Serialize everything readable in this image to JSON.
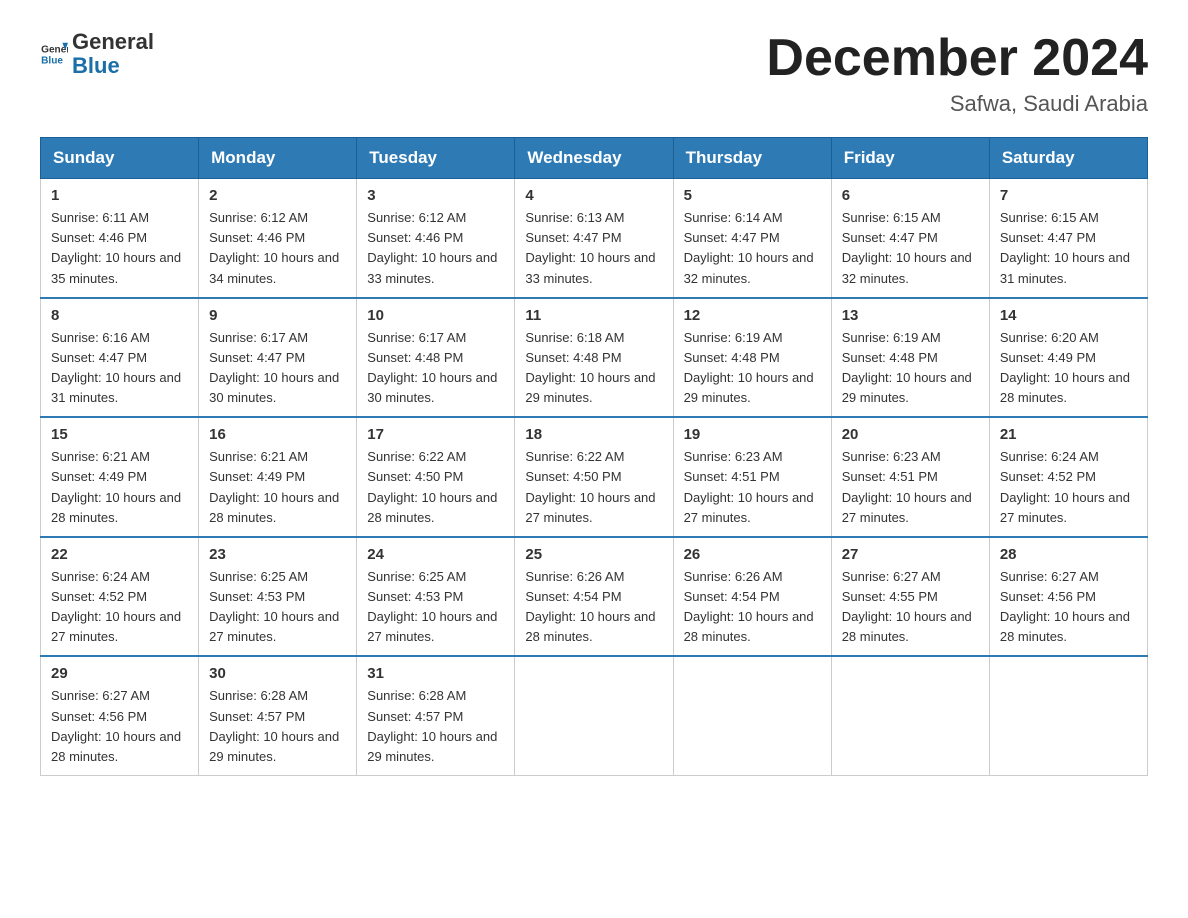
{
  "header": {
    "logo_general": "General",
    "logo_blue": "Blue",
    "month_title": "December 2024",
    "location": "Safwa, Saudi Arabia"
  },
  "days_of_week": [
    "Sunday",
    "Monday",
    "Tuesday",
    "Wednesday",
    "Thursday",
    "Friday",
    "Saturday"
  ],
  "weeks": [
    [
      {
        "day": "1",
        "sunrise": "6:11 AM",
        "sunset": "4:46 PM",
        "daylight": "10 hours and 35 minutes."
      },
      {
        "day": "2",
        "sunrise": "6:12 AM",
        "sunset": "4:46 PM",
        "daylight": "10 hours and 34 minutes."
      },
      {
        "day": "3",
        "sunrise": "6:12 AM",
        "sunset": "4:46 PM",
        "daylight": "10 hours and 33 minutes."
      },
      {
        "day": "4",
        "sunrise": "6:13 AM",
        "sunset": "4:47 PM",
        "daylight": "10 hours and 33 minutes."
      },
      {
        "day": "5",
        "sunrise": "6:14 AM",
        "sunset": "4:47 PM",
        "daylight": "10 hours and 32 minutes."
      },
      {
        "day": "6",
        "sunrise": "6:15 AM",
        "sunset": "4:47 PM",
        "daylight": "10 hours and 32 minutes."
      },
      {
        "day": "7",
        "sunrise": "6:15 AM",
        "sunset": "4:47 PM",
        "daylight": "10 hours and 31 minutes."
      }
    ],
    [
      {
        "day": "8",
        "sunrise": "6:16 AM",
        "sunset": "4:47 PM",
        "daylight": "10 hours and 31 minutes."
      },
      {
        "day": "9",
        "sunrise": "6:17 AM",
        "sunset": "4:47 PM",
        "daylight": "10 hours and 30 minutes."
      },
      {
        "day": "10",
        "sunrise": "6:17 AM",
        "sunset": "4:48 PM",
        "daylight": "10 hours and 30 minutes."
      },
      {
        "day": "11",
        "sunrise": "6:18 AM",
        "sunset": "4:48 PM",
        "daylight": "10 hours and 29 minutes."
      },
      {
        "day": "12",
        "sunrise": "6:19 AM",
        "sunset": "4:48 PM",
        "daylight": "10 hours and 29 minutes."
      },
      {
        "day": "13",
        "sunrise": "6:19 AM",
        "sunset": "4:48 PM",
        "daylight": "10 hours and 29 minutes."
      },
      {
        "day": "14",
        "sunrise": "6:20 AM",
        "sunset": "4:49 PM",
        "daylight": "10 hours and 28 minutes."
      }
    ],
    [
      {
        "day": "15",
        "sunrise": "6:21 AM",
        "sunset": "4:49 PM",
        "daylight": "10 hours and 28 minutes."
      },
      {
        "day": "16",
        "sunrise": "6:21 AM",
        "sunset": "4:49 PM",
        "daylight": "10 hours and 28 minutes."
      },
      {
        "day": "17",
        "sunrise": "6:22 AM",
        "sunset": "4:50 PM",
        "daylight": "10 hours and 28 minutes."
      },
      {
        "day": "18",
        "sunrise": "6:22 AM",
        "sunset": "4:50 PM",
        "daylight": "10 hours and 27 minutes."
      },
      {
        "day": "19",
        "sunrise": "6:23 AM",
        "sunset": "4:51 PM",
        "daylight": "10 hours and 27 minutes."
      },
      {
        "day": "20",
        "sunrise": "6:23 AM",
        "sunset": "4:51 PM",
        "daylight": "10 hours and 27 minutes."
      },
      {
        "day": "21",
        "sunrise": "6:24 AM",
        "sunset": "4:52 PM",
        "daylight": "10 hours and 27 minutes."
      }
    ],
    [
      {
        "day": "22",
        "sunrise": "6:24 AM",
        "sunset": "4:52 PM",
        "daylight": "10 hours and 27 minutes."
      },
      {
        "day": "23",
        "sunrise": "6:25 AM",
        "sunset": "4:53 PM",
        "daylight": "10 hours and 27 minutes."
      },
      {
        "day": "24",
        "sunrise": "6:25 AM",
        "sunset": "4:53 PM",
        "daylight": "10 hours and 27 minutes."
      },
      {
        "day": "25",
        "sunrise": "6:26 AM",
        "sunset": "4:54 PM",
        "daylight": "10 hours and 28 minutes."
      },
      {
        "day": "26",
        "sunrise": "6:26 AM",
        "sunset": "4:54 PM",
        "daylight": "10 hours and 28 minutes."
      },
      {
        "day": "27",
        "sunrise": "6:27 AM",
        "sunset": "4:55 PM",
        "daylight": "10 hours and 28 minutes."
      },
      {
        "day": "28",
        "sunrise": "6:27 AM",
        "sunset": "4:56 PM",
        "daylight": "10 hours and 28 minutes."
      }
    ],
    [
      {
        "day": "29",
        "sunrise": "6:27 AM",
        "sunset": "4:56 PM",
        "daylight": "10 hours and 28 minutes."
      },
      {
        "day": "30",
        "sunrise": "6:28 AM",
        "sunset": "4:57 PM",
        "daylight": "10 hours and 29 minutes."
      },
      {
        "day": "31",
        "sunrise": "6:28 AM",
        "sunset": "4:57 PM",
        "daylight": "10 hours and 29 minutes."
      },
      null,
      null,
      null,
      null
    ]
  ],
  "labels": {
    "sunrise": "Sunrise:",
    "sunset": "Sunset:",
    "daylight": "Daylight:"
  }
}
